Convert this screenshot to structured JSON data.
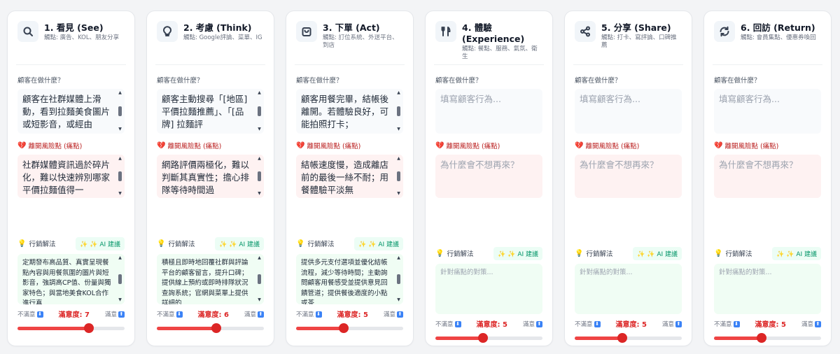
{
  "labels": {
    "action": "顧客在做什麼？",
    "pain": "離開風險點 (痛點)",
    "solution": "行銷解法",
    "ai": "✨ AI 建議",
    "unhappy": "不滿意",
    "happy": "滿意",
    "sat_prefix": "滿意度: ",
    "action_placeholder": "填寫顧客行為...",
    "pain_placeholder": "為什麼會不想再來？",
    "solution_placeholder": "針對痛點的對策..."
  },
  "colors": {
    "accent": "#dc2626",
    "pain_bg": "#fef2f2",
    "solution_bg": "#f0fdf4",
    "ai": "#059669"
  },
  "stages": [
    {
      "title": "1. 看見 (See)",
      "touchpoints": "觸點: 廣告、KOL、朋友分享",
      "icon": "search-icon",
      "action": "顧客在社群媒體上滑動，看到拉麵美食圖片或短影音，或經由",
      "pain": "社群媒體資訊過於碎片化，難以快速辨別哪家平價拉麵值得一",
      "solution": "定期發布高品質、真實呈現餐點內容與用餐氛圍的圖片與短影音，強調高CP值、份量與獨家特色；與當地美食KOL合作進行真",
      "satisfaction": 7
    },
    {
      "title": "2. 考慮 (Think)",
      "touchpoints": "觸點: Google評論、菜單、IG",
      "icon": "lightbulb-icon",
      "action": "顧客主動搜尋「[地區] 平價拉麵推薦」、「[品牌] 拉麵評",
      "pain": "網路評價兩極化，難以判斷其真實性；擔心排隊等待時間過",
      "solution": "積極且即時地回覆社群與評論平台的顧客留言，提升口碑；提供線上預約或即時排隊狀況查詢系統；官網與菜單上提供詳細的",
      "satisfaction": 6
    },
    {
      "title": "3. 下單 (Act)",
      "touchpoints": "觸點: 訂位系統、外送平台、到店",
      "icon": "shopping-bag-icon",
      "action": "顧客用餐完畢，結帳後離開。若體驗良好，可能拍照打卡；",
      "pain": "結帳速度慢，造成離店前的最後一絲不耐；用餐體驗平淡無",
      "solution": "提供多元支付選項並優化結帳流程，減少等待時間；主動詢問顧客用餐感受並提供意見回饋管道；提供餐後適度的小點或茶",
      "satisfaction": 5
    },
    {
      "title": "4. 體驗 (Experience)",
      "touchpoints": "觸點: 餐點、服務、氣氛、衛生",
      "icon": "utensils-icon",
      "action": "",
      "pain": "",
      "solution": "",
      "satisfaction": 5
    },
    {
      "title": "5. 分享 (Share)",
      "touchpoints": "觸點: 打卡、寫評論、口碑推薦",
      "icon": "share-icon",
      "action": "",
      "pain": "",
      "solution": "",
      "satisfaction": 5
    },
    {
      "title": "6. 回訪 (Return)",
      "touchpoints": "觸點: 會員集點、優惠券喚回",
      "icon": "refresh-icon",
      "action": "",
      "pain": "",
      "solution": "",
      "satisfaction": 5
    }
  ]
}
